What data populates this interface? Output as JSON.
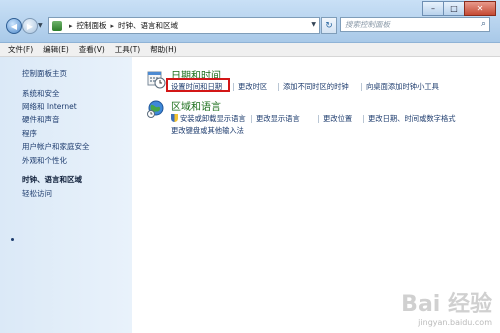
{
  "window_controls": {
    "minimize": "–",
    "maximize": "□",
    "close": "✕"
  },
  "address": {
    "crumbs": [
      "控制面板",
      "时钟、语言和区域"
    ],
    "separator": "▸"
  },
  "search": {
    "placeholder": "搜索控制面板"
  },
  "menu": [
    "文件(F)",
    "编辑(E)",
    "查看(V)",
    "工具(T)",
    "帮助(H)"
  ],
  "sidebar": {
    "home": "控制面板主页",
    "items": [
      "系统和安全",
      "网络和 Internet",
      "硬件和声音",
      "程序",
      "用户帐户和家庭安全",
      "外观和个性化",
      "时钟、语言和区域",
      "轻松访问"
    ],
    "selected_index": 6
  },
  "sections": {
    "datetime": {
      "title": "日期和时间",
      "links": [
        "设置时间和日期",
        "更改时区",
        "添加不同时区的时钟",
        "向桌面添加时钟小工具"
      ]
    },
    "region": {
      "title": "区域和语言",
      "links": [
        "安装或卸载显示语言",
        "更改显示语言",
        "更改位置",
        "更改日期、时间或数字格式",
        "更改键盘或其他输入法"
      ]
    }
  },
  "watermark": {
    "brand": "Bai 经验",
    "url": "jingyan.baidu.com"
  },
  "colors": {
    "highlight": "#d31616",
    "heading": "#1b6e1b",
    "link": "#1e3c6e"
  }
}
